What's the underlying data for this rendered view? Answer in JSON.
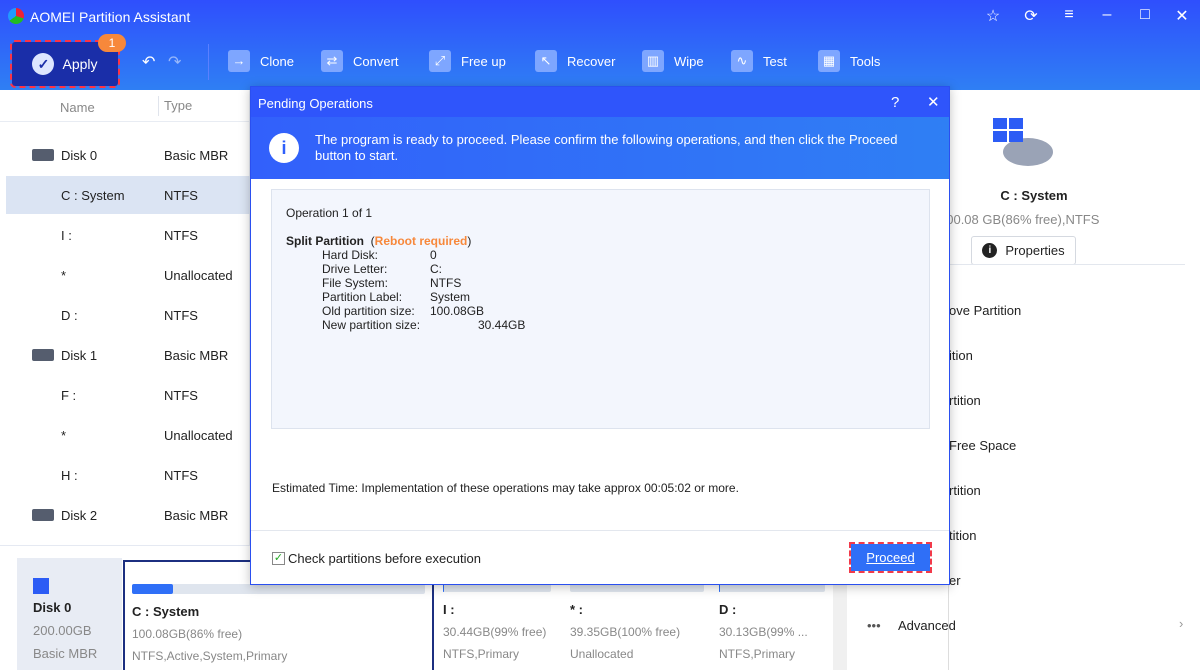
{
  "app": {
    "title": "AOMEI Partition Assistant"
  },
  "toolbar": {
    "apply": "Apply",
    "pending_count": "1",
    "items": [
      "Clone",
      "Convert",
      "Free up",
      "Recover",
      "Wipe",
      "Test",
      "Tools"
    ]
  },
  "left": {
    "headers": [
      "Name",
      "Type"
    ],
    "rows": [
      {
        "name": "Disk 0",
        "type": "Basic MBR",
        "disk": true
      },
      {
        "name": "C : System",
        "type": "NTFS",
        "selected": true
      },
      {
        "name": "I :",
        "type": "NTFS"
      },
      {
        "name": "*",
        "type": "Unallocated"
      },
      {
        "name": "D :",
        "type": "NTFS"
      },
      {
        "name": "Disk 1",
        "type": "Basic MBR",
        "disk": true
      },
      {
        "name": "F :",
        "type": "NTFS"
      },
      {
        "name": "*",
        "type": "Unallocated"
      },
      {
        "name": "H :",
        "type": "NTFS"
      },
      {
        "name": "Disk 2",
        "type": "Basic MBR",
        "disk": true
      }
    ]
  },
  "right": {
    "name": "C : System",
    "detail": "100.08 GB(86% free),NTFS",
    "properties": "Properties",
    "ops": [
      "ove Partition",
      "ition",
      "rtition",
      "Free Space",
      "rtition",
      "tition",
      "er"
    ],
    "advanced": "Advanced"
  },
  "diskmap": {
    "disk": {
      "name": "Disk 0",
      "size": "200.00GB",
      "type": "Basic MBR"
    },
    "parts": [
      {
        "name": "C : System",
        "size": "100.08GB(86% free)",
        "info": "NTFS,Active,System,Primary",
        "used": 0.14
      },
      {
        "name": "I :",
        "size": "30.44GB(99% free)",
        "info": "NTFS,Primary",
        "used": 0.01
      },
      {
        "name": "* :",
        "size": "39.35GB(100% free)",
        "info": "Unallocated",
        "used": 0
      },
      {
        "name": "D :",
        "size": "30.13GB(99% ...",
        "info": "NTFS,Primary",
        "used": 0.01
      }
    ]
  },
  "dialog": {
    "title": "Pending Operations",
    "help": "?",
    "message": "The program is ready to proceed. Please confirm the following operations, and then click the Proceed button to start.",
    "op_count": "Operation 1 of 1",
    "op_name": "Split Partition",
    "reboot": "Reboot required",
    "details": [
      {
        "k": "Hard Disk:",
        "v": "0"
      },
      {
        "k": "Drive Letter:",
        "v": "C:"
      },
      {
        "k": "File System:",
        "v": "NTFS"
      },
      {
        "k": "Partition Label:",
        "v": "System"
      },
      {
        "k": "Old partition size:",
        "v": "100.08GB"
      },
      {
        "k": "New partition size:",
        "v": "30.44GB"
      }
    ],
    "estimate": "Estimated Time: Implementation of these operations may take approx 00:05:02 or more.",
    "check_label": "Check partitions before execution",
    "checked": true,
    "proceed": "Proceed"
  },
  "colors": {
    "accent": "#2f55fb",
    "reboot": "#f7883b",
    "highlight": "#f23a4a"
  }
}
